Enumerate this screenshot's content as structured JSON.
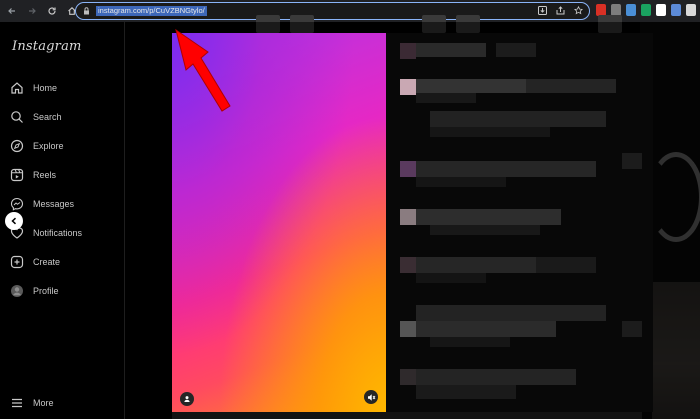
{
  "browser": {
    "url": "instagram.com/p/CuVZBNGtylo/",
    "toolbar_icons": [
      "back-icon",
      "forward-icon",
      "reload-icon",
      "home-icon"
    ],
    "omnibox_icons": [
      "install-icon",
      "share-icon",
      "bookmark-star-icon"
    ],
    "extension_colors": [
      "#d93025",
      "#7d7d7d",
      "#4a8fd6",
      "#1aa260",
      "#ffffff",
      "#5c8bd8",
      "#d9d9d9",
      "#cfcfcf"
    ]
  },
  "sidebar": {
    "logo": "Instagram",
    "items": [
      {
        "label": "Home",
        "icon": "home-icon"
      },
      {
        "label": "Search",
        "icon": "search-icon"
      },
      {
        "label": "Explore",
        "icon": "compass-icon"
      },
      {
        "label": "Reels",
        "icon": "reels-icon"
      },
      {
        "label": "Messages",
        "icon": "messenger-icon"
      },
      {
        "label": "Notifications",
        "icon": "heart-icon"
      },
      {
        "label": "Create",
        "icon": "plus-square-icon"
      },
      {
        "label": "Profile",
        "icon": "avatar"
      }
    ],
    "more": {
      "label": "More",
      "icon": "menu-icon"
    }
  },
  "post_modal": {
    "media": {
      "type": "video",
      "background": "purple-pink-orange gradient"
    },
    "left_control": "user-tag-icon",
    "right_control": "mute-icon",
    "comments_state": "pixelated / blurred"
  },
  "annotation": {
    "arrow_color": "#ff0000",
    "points_to": "address-bar"
  },
  "colors": {
    "accent": "#8ab4f8",
    "url_highlight": "#3d67b8",
    "arrow": "#ff0000"
  }
}
